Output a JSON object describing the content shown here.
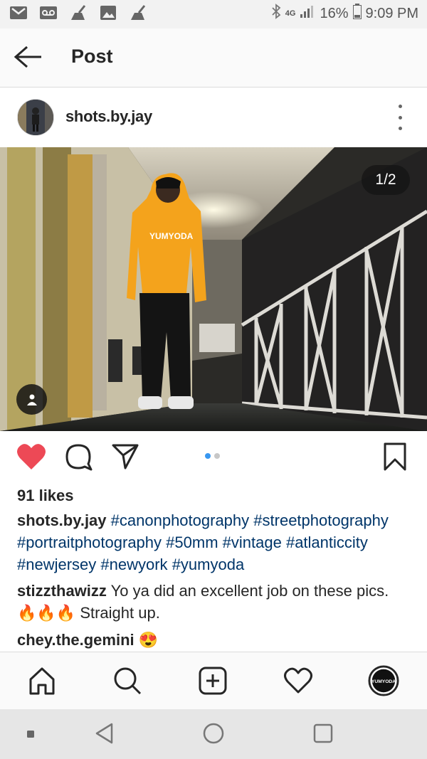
{
  "status_bar": {
    "left_icons": [
      "gmail-icon",
      "voicemail-icon",
      "cleaner-icon",
      "gallery-icon",
      "cleaner-icon"
    ],
    "network": "4G",
    "battery": "16%",
    "time": "9:09 PM"
  },
  "app_bar": {
    "title": "Post"
  },
  "post": {
    "username": "shots.by.jay",
    "counter": "1/2",
    "likes": "91 likes",
    "caption": {
      "username": "shots.by.jay",
      "hashtags": [
        "#canonphotography",
        "#streetphotography",
        "#portraitphotography",
        "#50mm",
        "#vintage",
        "#atlanticcity",
        "#newjersey",
        "#newyork",
        "#yumyoda"
      ]
    },
    "comments": [
      {
        "username": "stizzthawizz",
        "text": "Yo ya did an excellent job on these pics.",
        "emoji": "🔥🔥🔥",
        "suffix": "Straight up."
      },
      {
        "username": "chey.the.gemini",
        "emoji": "😍"
      }
    ],
    "carousel": {
      "total": 2,
      "active": 1
    },
    "hoodie_print": "YUMYODA"
  },
  "colors": {
    "like_red": "#ed4956",
    "hashtag_blue": "#003569",
    "dot_active": "#3897f0",
    "dot_inactive": "#c7c7c7"
  }
}
